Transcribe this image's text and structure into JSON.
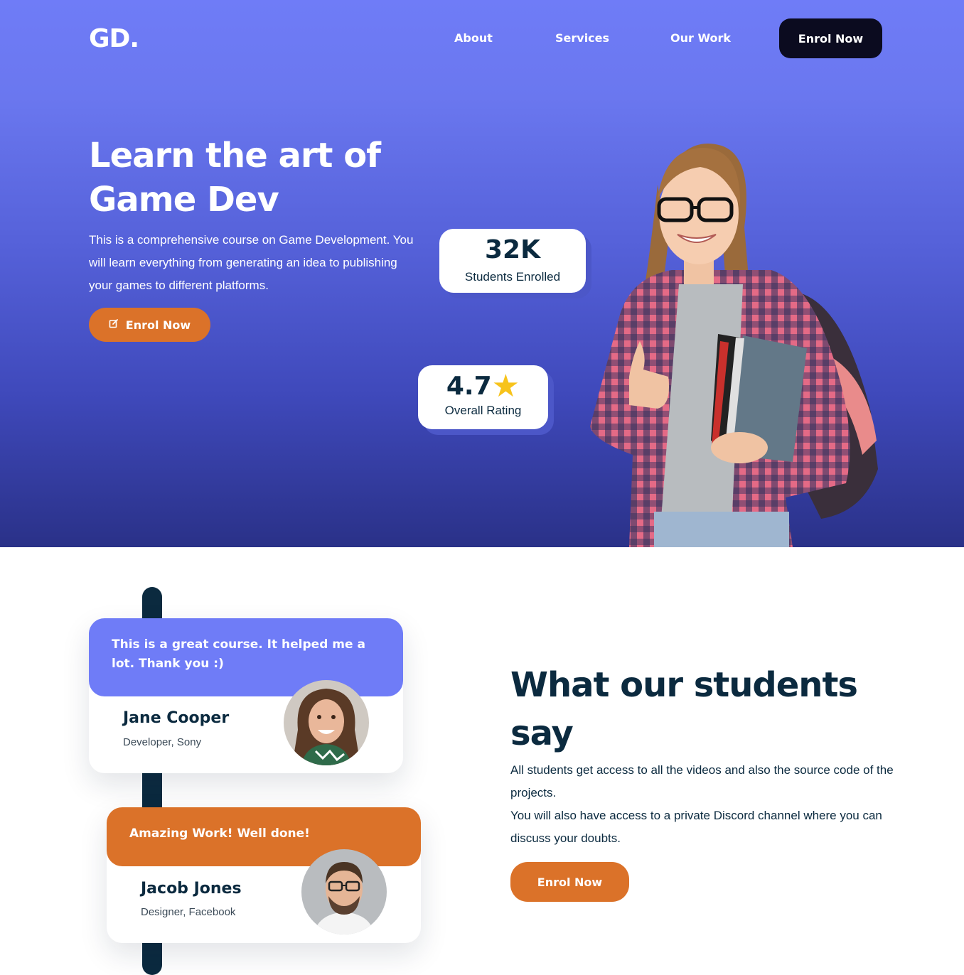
{
  "header": {
    "logo": "GD.",
    "nav": [
      {
        "label": "About"
      },
      {
        "label": "Services"
      },
      {
        "label": "Our Work"
      }
    ],
    "cta_label": "Enrol Now"
  },
  "hero": {
    "title": "Learn the art of Game Dev",
    "description": "This is a comprehensive course on Game Development. You will learn everything from generating an idea to publishing your games to different platforms.",
    "cta_label": "Enrol Now",
    "cta_icon": "edit-icon",
    "stats": {
      "students": {
        "value": "32K",
        "label": "Students Enrolled"
      },
      "rating": {
        "value": "4.7",
        "icon": "star-icon",
        "label": "Overall Rating"
      }
    }
  },
  "testimonials": [
    {
      "quote": "This is a great course. It helped me a lot. Thank you :)",
      "name": "Jane Cooper",
      "role": "Developer, Sony",
      "accent": "#6f7cf7"
    },
    {
      "quote": "Amazing Work! Well done!",
      "name": "Jacob Jones",
      "role": "Designer, Facebook",
      "accent": "#db7229"
    }
  ],
  "students_say": {
    "title": "What our students say",
    "paragraph_1": "All students get access to all the videos and also the source code of the projects.",
    "paragraph_2": "You will also have access to a private Discord channel where you can discuss your doubts.",
    "cta_label": "Enrol Now"
  },
  "colors": {
    "primary": "#6f7cf7",
    "accent": "#db7229",
    "dark": "#0b2a3f",
    "nav_button": "#0b0b1f",
    "star": "#f7c31b"
  }
}
